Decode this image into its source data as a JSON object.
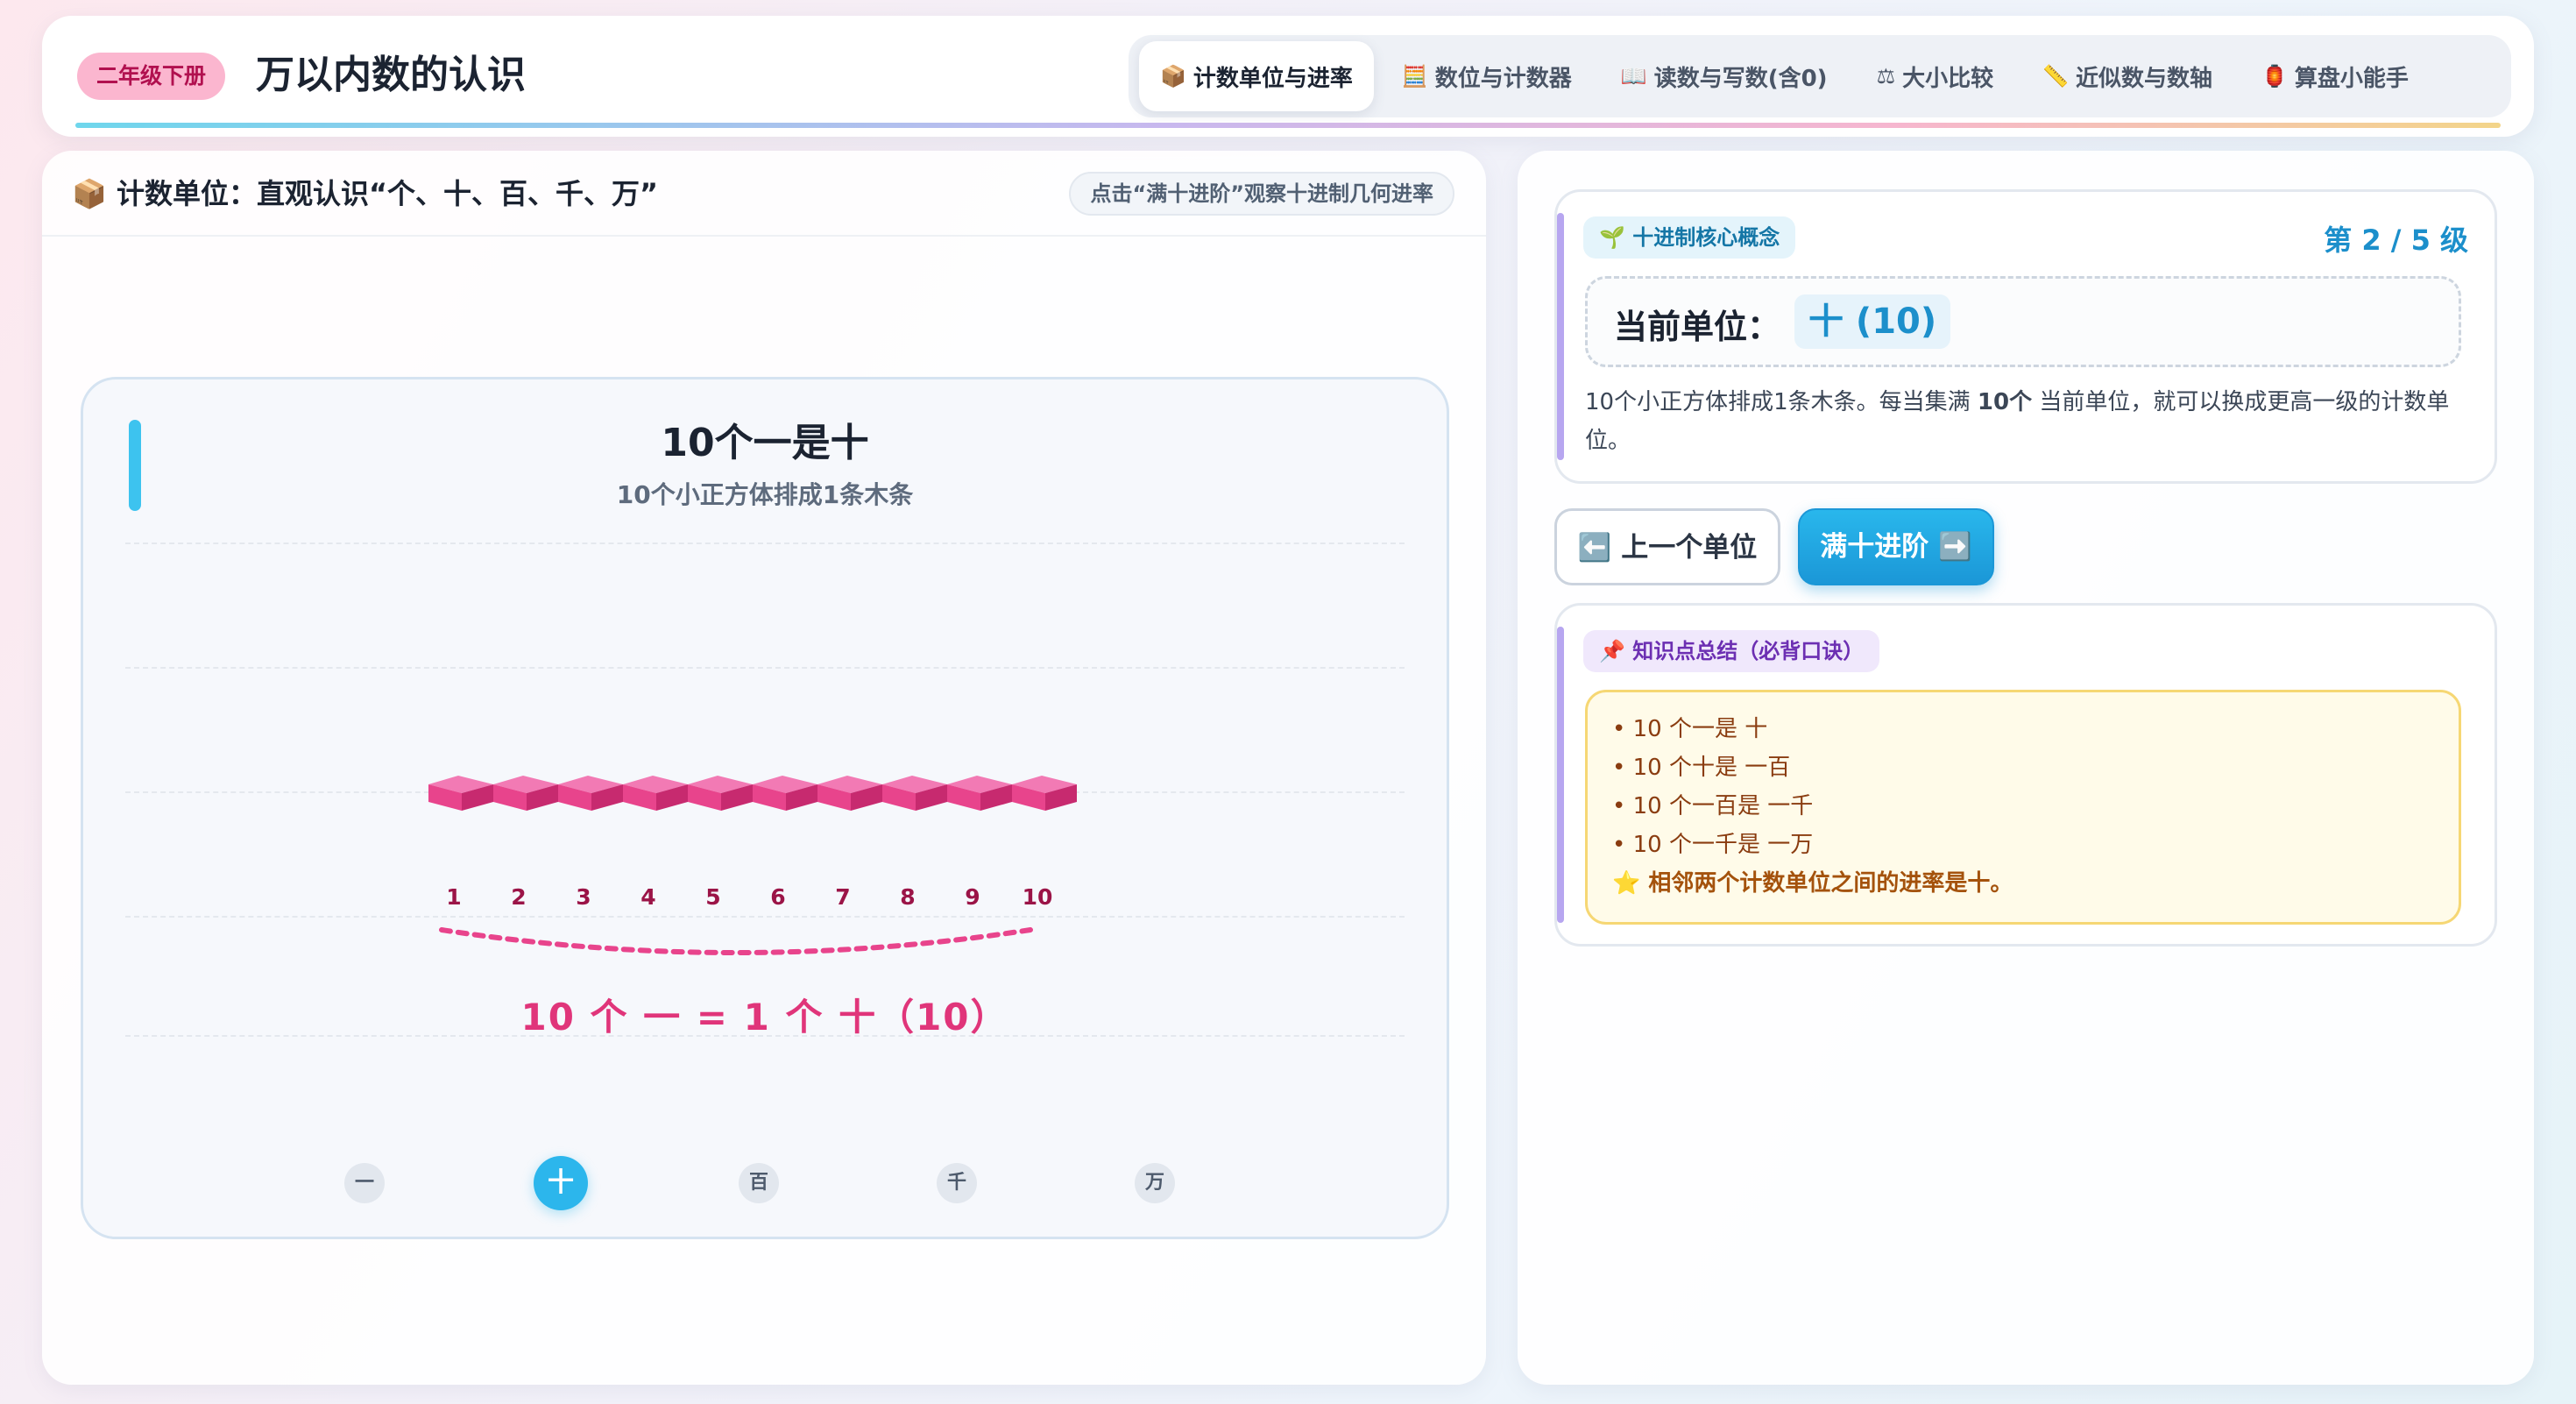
{
  "header": {
    "badge": "二年级下册",
    "title": "万以内数的认识",
    "tabs": [
      {
        "icon": "📦",
        "icon_name": "box-icon",
        "label": "计数单位与进率",
        "active": true
      },
      {
        "icon": "🧮",
        "icon_name": "abacus-icon",
        "label": "数位与计数器",
        "active": false
      },
      {
        "icon": "📖",
        "icon_name": "book-icon",
        "label": "读数与写数(含0)",
        "active": false
      },
      {
        "icon": "⚖",
        "icon_name": "scale-icon",
        "label": "大小比较",
        "active": false
      },
      {
        "icon": "📏",
        "icon_name": "ruler-icon",
        "label": "近似数与数轴",
        "active": false
      },
      {
        "icon": "🏮",
        "icon_name": "lantern-icon",
        "label": "算盘小能手",
        "active": false
      }
    ]
  },
  "left": {
    "icon": "📦",
    "title": "计数单位：直观认识“个、十、百、千、万”",
    "hint": "点击“满十进阶”观察十进制几何进率",
    "stage": {
      "title": "10个一是十",
      "subtitle": "10个小正方体排成1条木条",
      "cube_count": 10,
      "numbers": [
        "1",
        "2",
        "3",
        "4",
        "5",
        "6",
        "7",
        "8",
        "9",
        "10"
      ],
      "equation": "10 个 一 = 1 个 十（10）",
      "units": [
        {
          "label": "一",
          "active": false
        },
        {
          "label": "十",
          "active": true
        },
        {
          "label": "百",
          "active": false
        },
        {
          "label": "千",
          "active": false
        },
        {
          "label": "万",
          "active": false
        }
      ]
    }
  },
  "right": {
    "concept": {
      "chip": "🌱 十进制核心概念",
      "level": "第 2 / 5 级",
      "unit_label": "当前单位：",
      "unit_value": "十 (10)",
      "desc_a": "10个小正方体排成1条木条。每当集满 ",
      "desc_b": "10个",
      "desc_c": " 当前单位，就可以换成更高一级的计数单位。"
    },
    "buttons": {
      "prev": "⬅️ 上一个单位",
      "next": "满十进阶 ➡️"
    },
    "summary": {
      "chip": "📌 知识点总结（必背口诀）",
      "items": [
        "• 10 个一是 十",
        "• 10 个十是 一百",
        "• 10 个一百是 一千",
        "• 10 个一千是 一万"
      ],
      "star": "⭐ 相邻两个计数单位之间的进率是十。"
    }
  },
  "colors": {
    "accent": "#2cb6ec",
    "cube": "#e8448c",
    "equation": "#e0357a",
    "badge_bg": "#fbb6cf"
  }
}
